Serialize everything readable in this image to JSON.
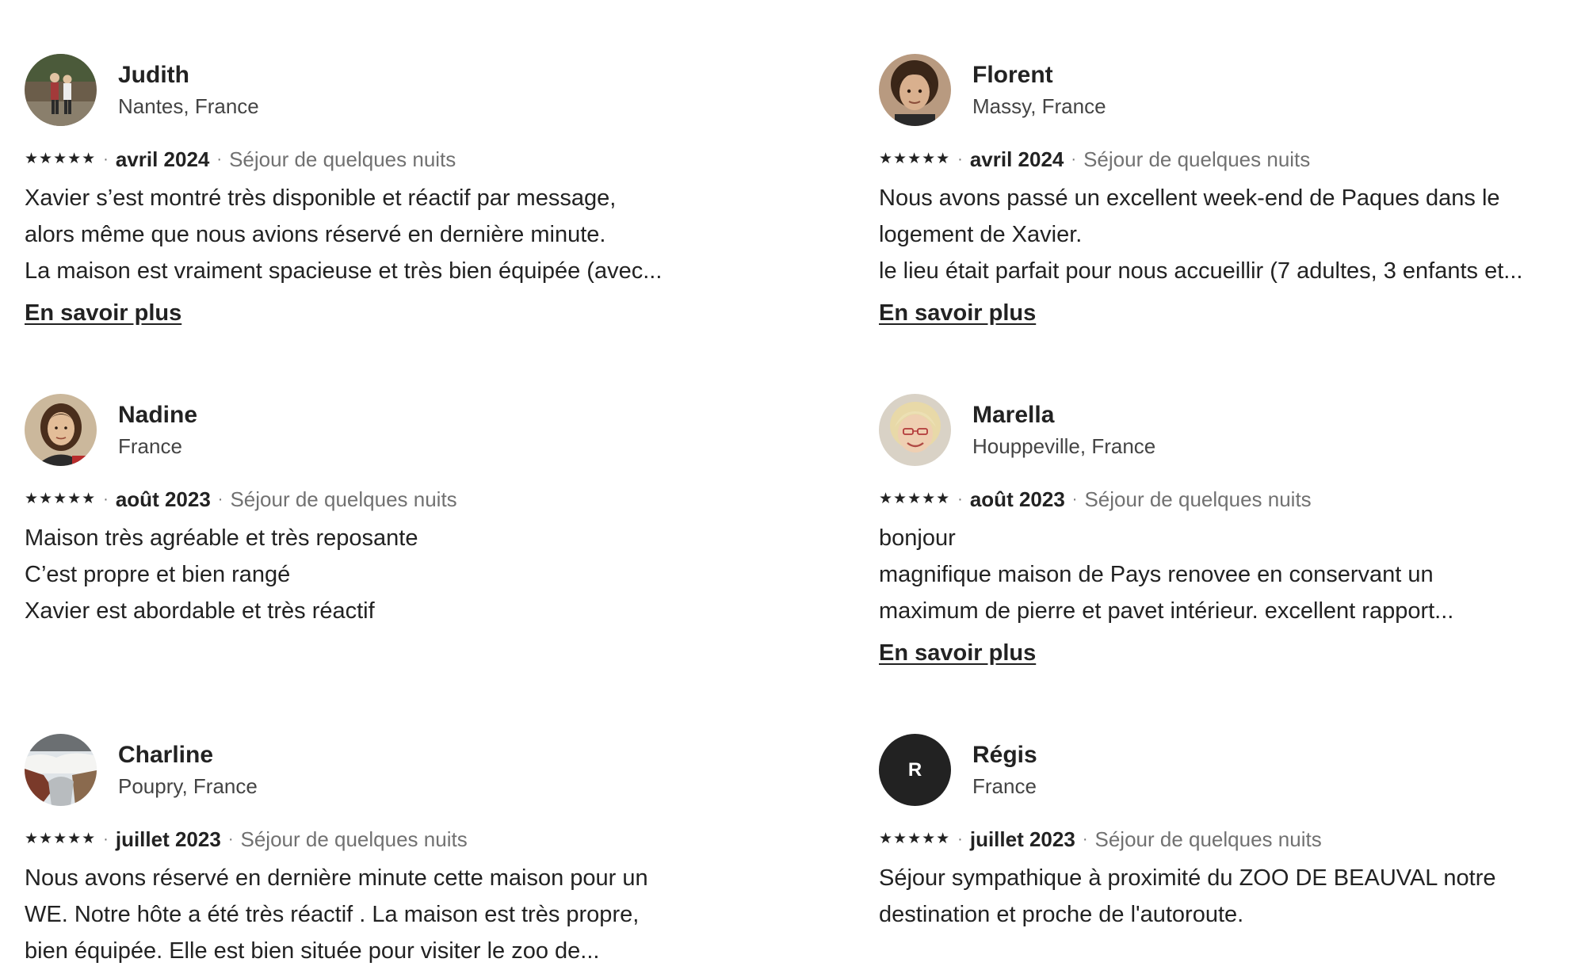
{
  "reviews": [
    {
      "name": "Judith",
      "location": "Nantes, France",
      "rating_stars": "★★★★★",
      "rating": 5,
      "date": "avril 2024",
      "stay": "Séjour de quelques nuits",
      "lines": [
        "Xavier s’est montré très disponible et réactif par message,",
        "alors même que nous avions réservé en dernière minute.",
        "La maison est vraiment spacieuse et très bien équipée (avec..."
      ],
      "more": "En savoir plus"
    },
    {
      "name": "Florent",
      "location": "Massy, France",
      "rating_stars": "★★★★★",
      "rating": 5,
      "date": "avril 2024",
      "stay": "Séjour de quelques nuits",
      "lines": [
        "Nous avons passé un excellent week-end de Paques dans le",
        "logement de Xavier.",
        "le lieu était parfait pour nous accueillir (7 adultes, 3 enfants et..."
      ],
      "more": "En savoir plus"
    },
    {
      "name": "Nadine",
      "location": "France",
      "rating_stars": "★★★★★",
      "rating": 5,
      "date": "août 2023",
      "stay": "Séjour de quelques nuits",
      "lines": [
        "Maison très agréable et très reposante",
        "C’est propre et bien rangé",
        "Xavier est abordable et très réactif"
      ]
    },
    {
      "name": "Marella",
      "location": "Houppeville, France",
      "rating_stars": "★★★★★",
      "rating": 5,
      "date": "août 2023",
      "stay": "Séjour de quelques nuits",
      "lines": [
        "bonjour",
        "magnifique maison de Pays renovee en conservant un",
        "maximum de pierre et pavet intérieur. excellent rapport..."
      ],
      "more": "En savoir plus"
    },
    {
      "name": "Charline",
      "location": "Poupry, France",
      "rating_stars": "★★★★★",
      "rating": 5,
      "date": "juillet 2023",
      "stay": "Séjour de quelques nuits",
      "lines": [
        "Nous avons réservé en dernière minute cette maison pour un",
        "WE. Notre hôte a été très réactif . La maison est très propre,",
        "bien équipée. Elle est bien située pour visiter le zoo de..."
      ]
    },
    {
      "name": "Régis",
      "location": "France",
      "avatar_initial": "R",
      "rating_stars": "★★★★★",
      "rating": 5,
      "date": "juillet 2023",
      "stay": "Séjour de quelques nuits",
      "lines": [
        "Séjour sympathique à proximité du ZOO DE BEAUVAL notre",
        "destination et proche de l'autoroute."
      ]
    }
  ],
  "colors": {
    "text": "#222222",
    "muted": "#717171",
    "avatar_initial_bg": "#222222"
  }
}
